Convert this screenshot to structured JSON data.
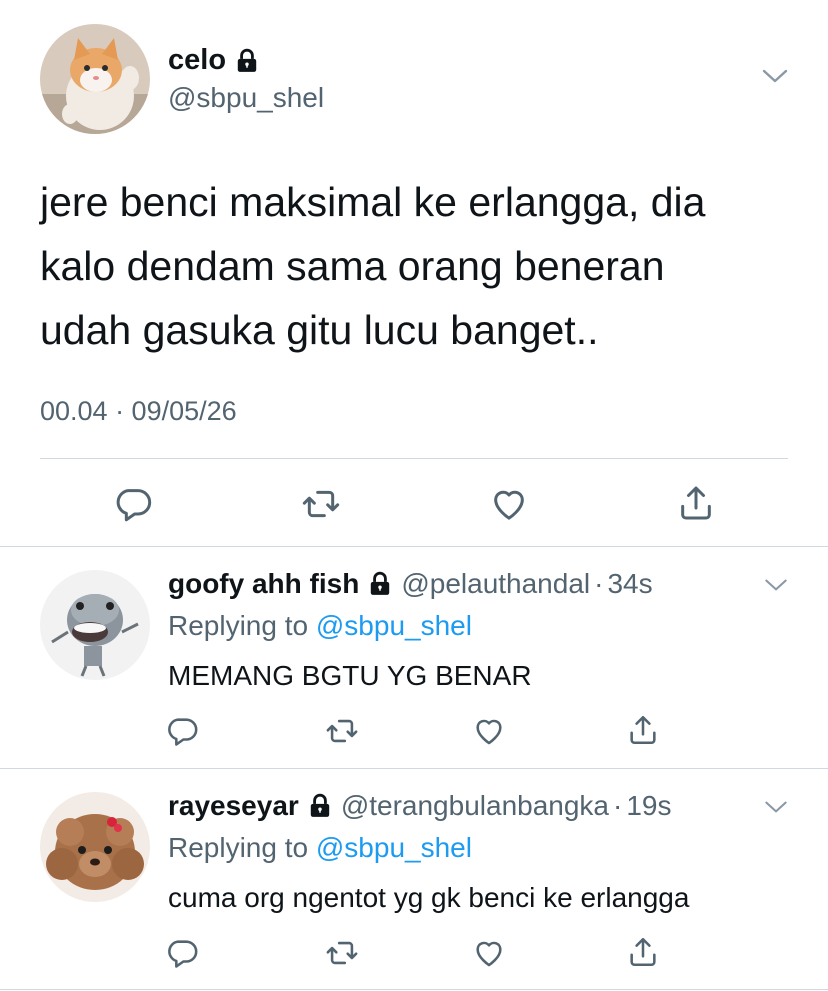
{
  "main_tweet": {
    "display_name": "celo",
    "handle": "@sbpu_shel",
    "text": "jere benci maksimal ke erlangga, dia\nkalo dendam sama orang beneran\nudah gasuka gitu lucu banget..",
    "timestamp": "00.04 · 09/05/26",
    "protected": true
  },
  "replies": [
    {
      "display_name": "goofy ahh fish",
      "handle": "@pelauthandal",
      "dot": "·",
      "time": "34s",
      "replying_prefix": "Replying to ",
      "replying_to": "@sbpu_shel",
      "text": "MEMANG BGTU YG BENAR",
      "protected": true
    },
    {
      "display_name": "rayeseyar",
      "handle": "@terangbulanbangka",
      "dot": "·",
      "time": "19s",
      "replying_prefix": "Replying to ",
      "replying_to": "@sbpu_shel",
      "text": "cuma org ngentot yg gk benci ke erlangga",
      "protected": true
    }
  ],
  "icons": {
    "reply": "speech-bubble-icon",
    "retweet": "retweet-arrows-icon",
    "like": "heart-icon",
    "share": "share-upload-icon",
    "more": "chevron-down-icon",
    "protected": "lock-icon"
  },
  "colors": {
    "text_primary": "#0f1419",
    "text_secondary": "#536471",
    "link": "#1d9bf0",
    "divider": "#cfd9de",
    "background": "#ffffff"
  }
}
